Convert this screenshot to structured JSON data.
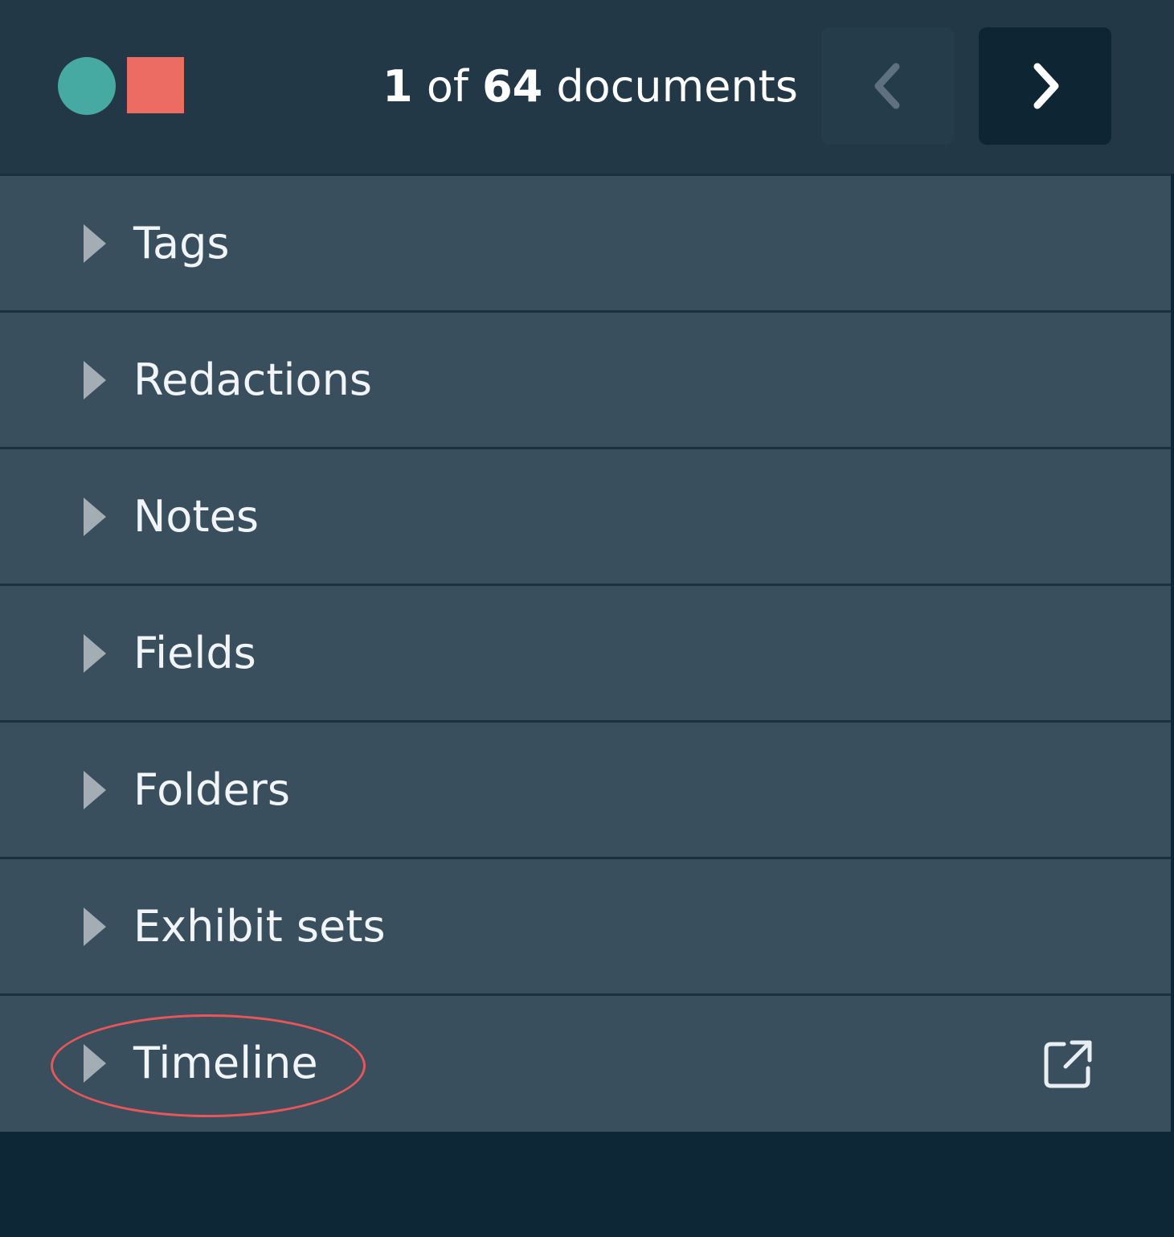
{
  "header": {
    "current": "1",
    "of_word": "of",
    "total": "64",
    "unit": "documents",
    "prev_icon": "chevron-left-icon",
    "next_icon": "chevron-right-icon"
  },
  "markers": {
    "circle_color": "#46aaa3",
    "square_color": "#ec6c64"
  },
  "sections": [
    {
      "label": "Tags"
    },
    {
      "label": "Redactions"
    },
    {
      "label": "Notes"
    },
    {
      "label": "Fields"
    },
    {
      "label": "Folders"
    },
    {
      "label": "Exhibit sets"
    },
    {
      "label": "Timeline",
      "icon": "external-link-icon"
    }
  ],
  "colors": {
    "panel": "#394f5d",
    "header": "#223847",
    "background": "#0d2737",
    "annotation": "#e8565a"
  }
}
